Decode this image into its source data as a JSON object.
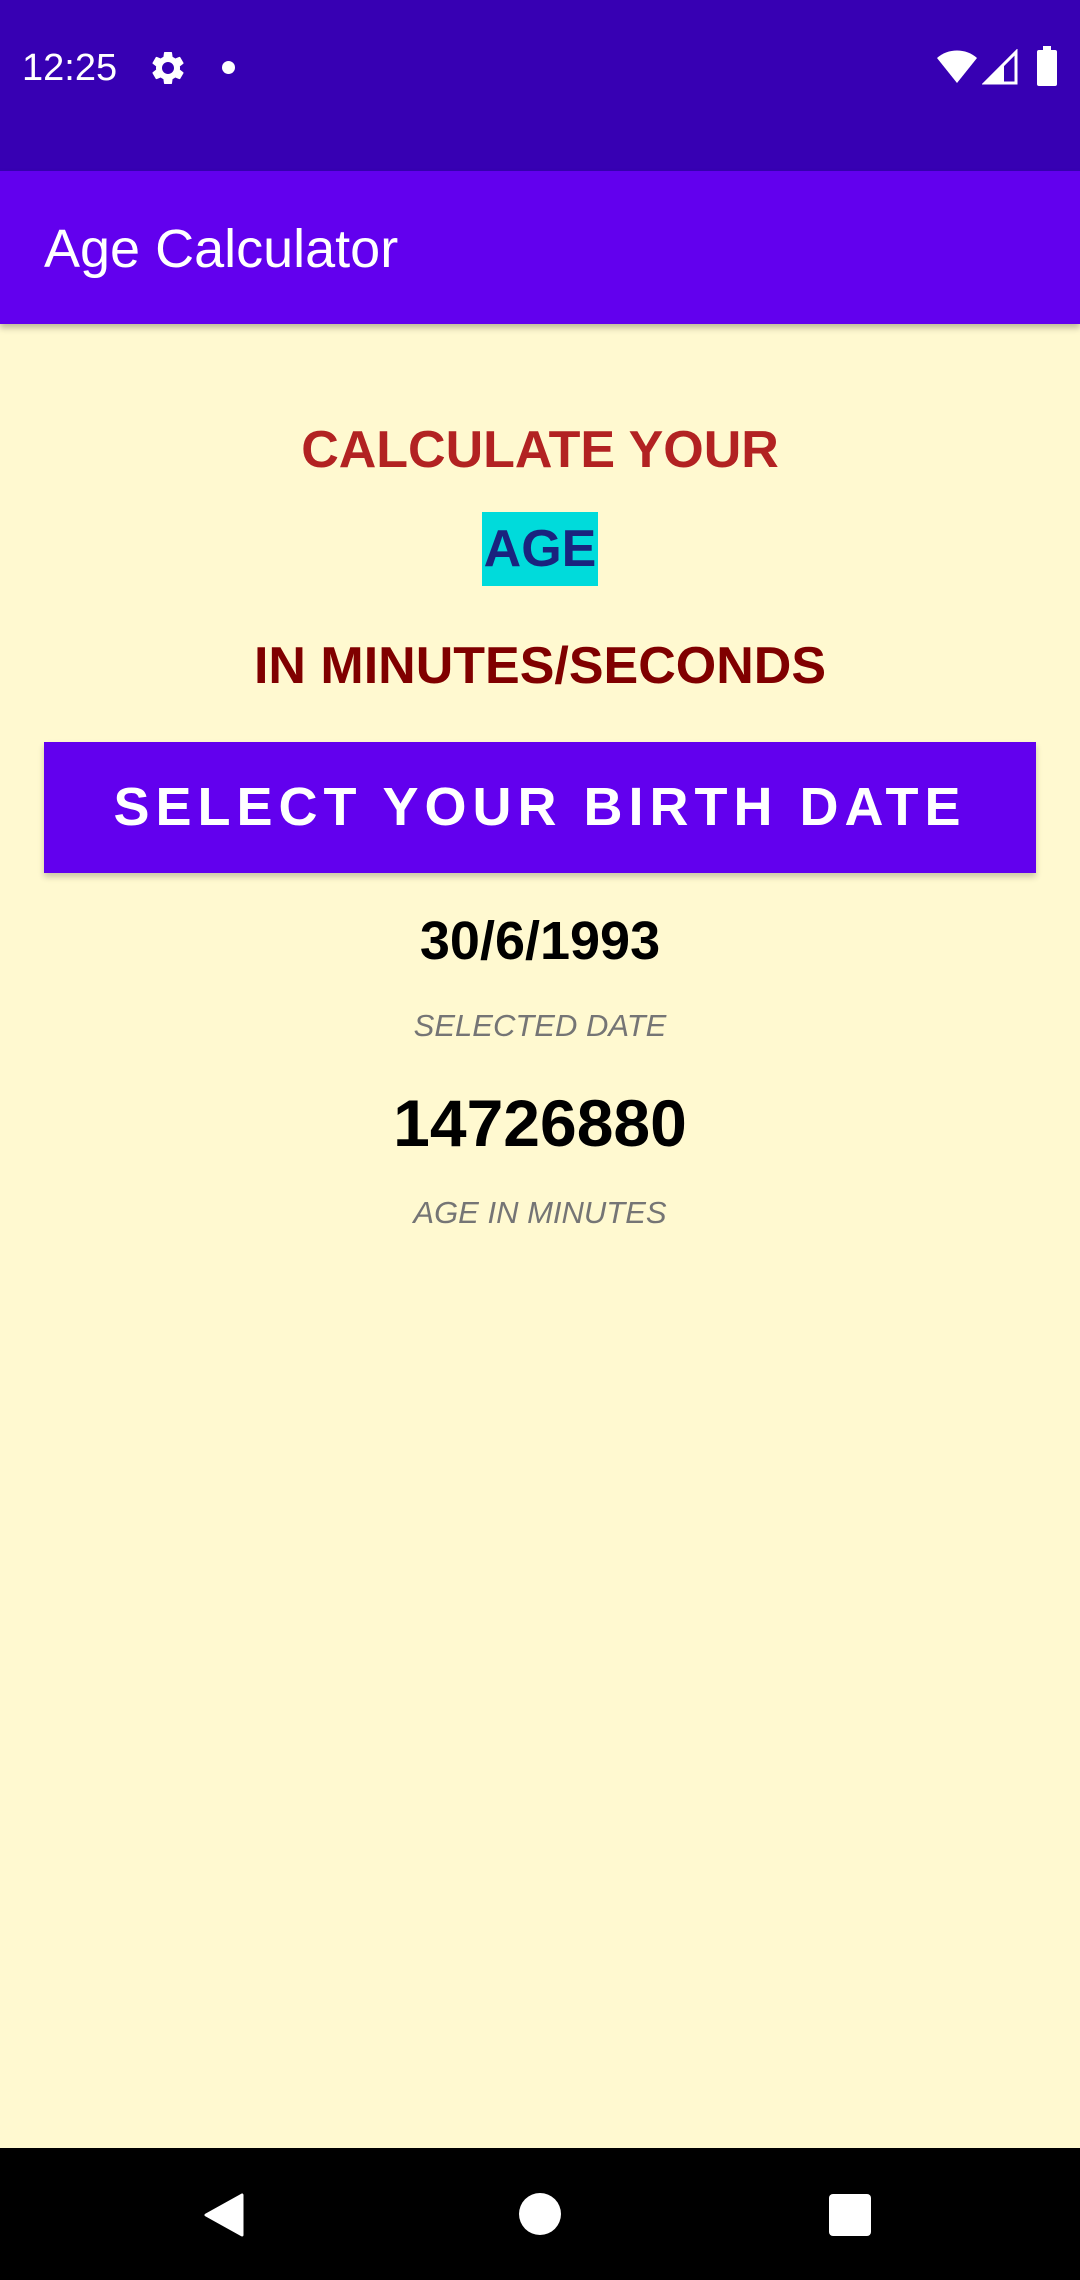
{
  "status_bar": {
    "time": "12:25",
    "icons": [
      "gear-icon",
      "notification-dot-icon",
      "wifi-icon",
      "signal-icon",
      "battery-icon"
    ]
  },
  "app_bar": {
    "title": "Age Calculator"
  },
  "heading": {
    "line1": "CALCULATE YOUR",
    "line2": "AGE",
    "line3": "IN MINUTES/SECONDS"
  },
  "birth_date_button": {
    "label": "SELECT YOUR BIRTH DATE"
  },
  "selected_date": {
    "value": "30/6/1993",
    "label": "SELECTED DATE"
  },
  "age_in_minutes": {
    "value": "14726880",
    "label": "AGE IN MINUTES"
  },
  "nav_bar": {
    "icons": [
      "back-icon",
      "home-icon",
      "recents-icon"
    ]
  },
  "colors": {
    "status_bar": "#3700B3",
    "app_bar": "#6200EE",
    "background": "#FFF9D0",
    "heading_line1": "#B22222",
    "age_highlight_bg": "#00DBDB",
    "age_text": "#1A237E",
    "heading_line3": "#800000",
    "caption": "#757575"
  }
}
